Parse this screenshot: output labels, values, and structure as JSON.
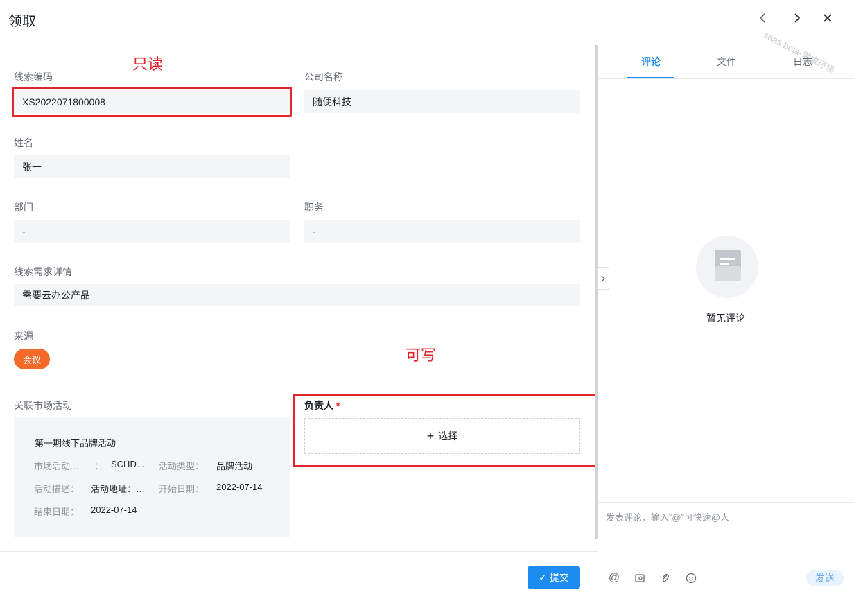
{
  "header": {
    "title": "领取",
    "watermark": "saas-beta-需求环境"
  },
  "annotations": {
    "readonly": "只读",
    "writable": "可写"
  },
  "form": {
    "clue_code": {
      "label": "线索编码",
      "value": "XS2022071800008"
    },
    "company": {
      "label": "公司名称",
      "value": "随便科技"
    },
    "name": {
      "label": "姓名",
      "value": "张一"
    },
    "department": {
      "label": "部门",
      "value": "-"
    },
    "position": {
      "label": "职务",
      "value": "-"
    },
    "detail": {
      "label": "线索需求详情",
      "value": "需要云办公产品"
    },
    "source": {
      "label": "来源",
      "value": "会议"
    },
    "campaign": {
      "label": "关联市场活动",
      "title": "第一期线下品牌活动",
      "k1": "市场活动…",
      "sep1": "：",
      "v1": "SCHD…",
      "k2": "活动类型：",
      "v2": "品牌活动",
      "k3": "活动描述：",
      "k3b": "活动地址：…",
      "k4": "开始日期：",
      "v4": "2022-07-14",
      "k5": "结束日期：",
      "v5": "2022-07-14"
    },
    "owner": {
      "label": "负责人",
      "required_mark": "*",
      "select_label": "选择",
      "plus": "+"
    }
  },
  "footer": {
    "submit_label": "提交",
    "submit_check": "✓"
  },
  "side": {
    "tabs": [
      {
        "label": "评论"
      },
      {
        "label": "文件"
      },
      {
        "label": "日志"
      }
    ],
    "empty_text": "暂无评论",
    "composer_placeholder": "发表评论，输入“@”可快速@人",
    "send_label": "发送"
  }
}
